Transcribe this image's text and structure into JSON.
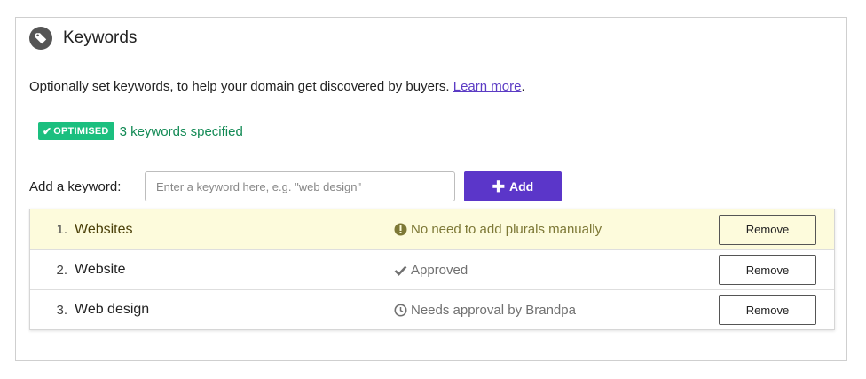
{
  "header": {
    "title": "Keywords",
    "icon": "tag-icon"
  },
  "intro": {
    "text": "Optionally set keywords, to help your domain get discovered by buyers. ",
    "link": "Learn more",
    "after": "."
  },
  "status": {
    "badge": "OPTIMISED",
    "text": "3 keywords specified",
    "badge_color": "#1bbf7f",
    "text_color": "#138a55"
  },
  "add": {
    "label": "Add a keyword:",
    "placeholder": "Enter a keyword here, e.g. \"web design\"",
    "button": "Add",
    "button_color": "#5b36c9"
  },
  "keywords": [
    {
      "num": "1.",
      "name": "Websites",
      "status": "No need to add plurals manually",
      "status_icon": "exclamation-circle-icon",
      "remove": "Remove"
    },
    {
      "num": "2.",
      "name": "Website",
      "status": "Approved",
      "status_icon": "check-icon",
      "remove": "Remove"
    },
    {
      "num": "3.",
      "name": "Web design",
      "status": "Needs approval by Brandpa",
      "status_icon": "clock-icon",
      "remove": "Remove"
    }
  ]
}
